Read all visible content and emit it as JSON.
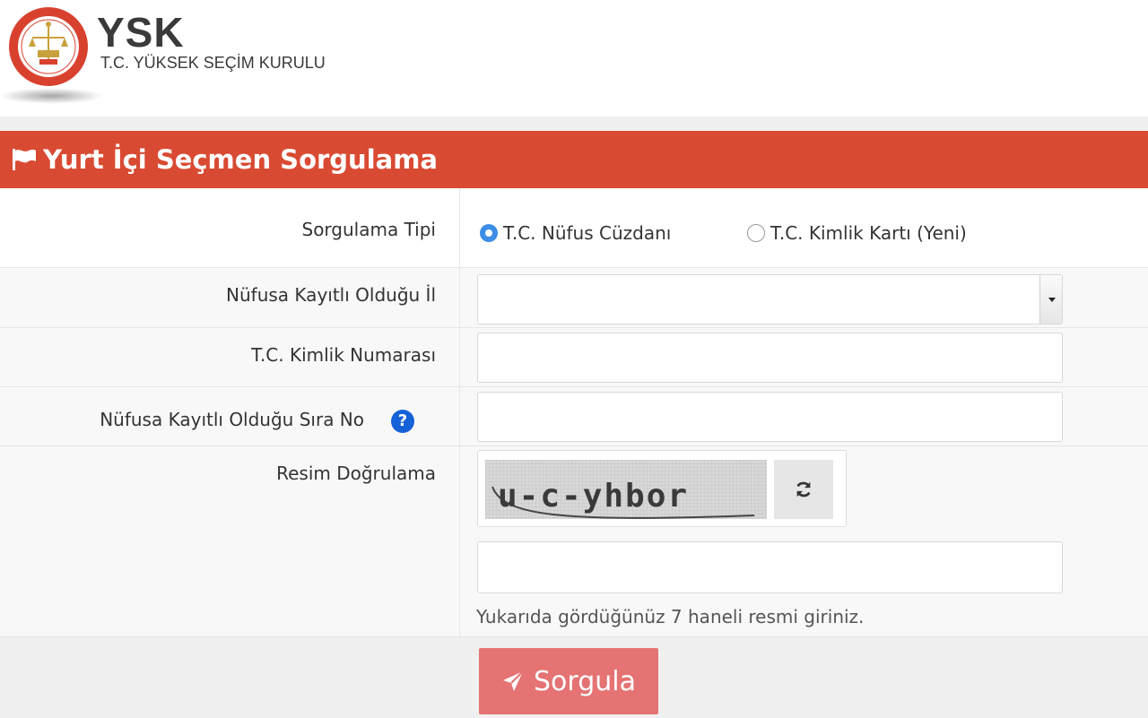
{
  "header": {
    "logo_title": "YSK",
    "logo_subtitle": "T.C. YÜKSEK SEÇİM KURULU"
  },
  "panel": {
    "title": "Yurt İçi Seçmen Sorgulama",
    "icon": "flag-icon",
    "color": "#d94a32"
  },
  "form": {
    "query_type": {
      "label": "Sorgulama Tipi",
      "options": [
        {
          "label": "T.C. Nüfus Cüzdanı",
          "checked": true
        },
        {
          "label": "T.C. Kimlik Kartı (Yeni)",
          "checked": false
        }
      ]
    },
    "province": {
      "label": "Nüfusa Kayıtlı Olduğu İl",
      "value": ""
    },
    "tc_number": {
      "label": "T.C. Kimlik Numarası",
      "value": ""
    },
    "sira_no": {
      "label": "Nüfusa Kayıtlı Olduğu Sıra No",
      "help_icon": "question-circle-icon",
      "value": ""
    },
    "captcha": {
      "label": "Resim Doğrulama",
      "image_text": "u-c-yhbor",
      "refresh_icon": "refresh-icon",
      "value": "",
      "hint": "Yukarıda gördüğünüz 7 haneli resmi giriniz."
    }
  },
  "submit": {
    "label": "Sorgula",
    "icon": "paper-plane-icon",
    "color": "#e57373"
  }
}
